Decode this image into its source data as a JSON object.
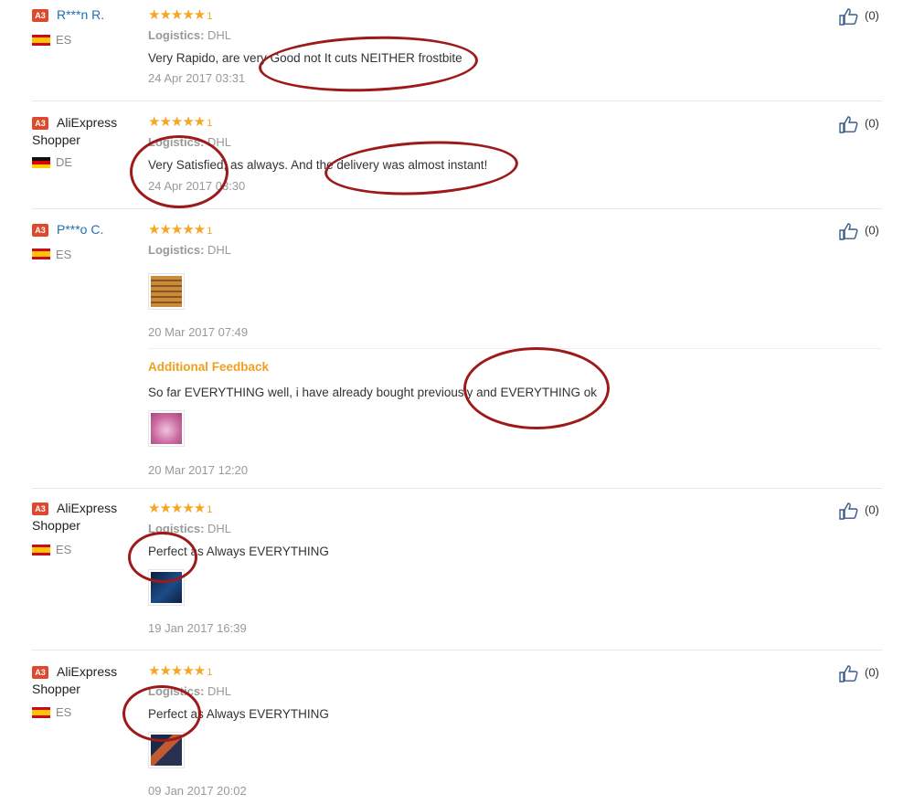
{
  "reviews": [
    {
      "badge": "A3",
      "user": "R***n R.",
      "country": "ES",
      "logistics_label": "Logistics:",
      "logistics": "DHL",
      "rating": "★★★★★",
      "rating_suffix": "1",
      "text": "Very Rapido, are very Good not It cuts NEITHER frostbite",
      "date": "24 Apr 2017 03:31",
      "likes": "(0)"
    },
    {
      "badge": "A3",
      "user": "AliExpress Shopper",
      "country": "DE",
      "logistics_label": "Logistics:",
      "logistics": "DHL",
      "rating": "★★★★★",
      "rating_suffix": "1",
      "text": "Very Satisfied, as always. And the delivery was almost instant!",
      "date": "24 Apr 2017 03:30",
      "likes": "(0)"
    },
    {
      "badge": "A3",
      "user": "P***o C.",
      "country": "ES",
      "logistics_label": "Logistics:",
      "logistics": "DHL",
      "rating": "★★★★★",
      "rating_suffix": "1",
      "date": "20 Mar 2017 07:49",
      "additional_label": "Additional Feedback",
      "additional_text": "So far EVERYTHING well, i have already bought previously and EVERYTHING ok",
      "additional_date": "20 Mar 2017 12:20",
      "likes": "(0)"
    },
    {
      "badge": "A3",
      "user": "AliExpress Shopper",
      "country": "ES",
      "logistics_label": "Logistics:",
      "logistics": "DHL",
      "rating": "★★★★★",
      "rating_suffix": "1",
      "text": "Perfect as Always EVERYTHING",
      "date": "19 Jan 2017 16:39",
      "likes": "(0)"
    },
    {
      "badge": "A3",
      "user": "AliExpress Shopper",
      "country": "ES",
      "logistics_label": "Logistics:",
      "logistics": "DHL",
      "rating": "★★★★★",
      "rating_suffix": "1",
      "text": "Perfect as Always EVERYTHING",
      "date": "09 Jan 2017 20:02",
      "likes": "(0)"
    }
  ],
  "colors": {
    "star": "#f5a623",
    "link": "#1f6fb5",
    "badge": "#e0482e",
    "annotation": "#9e1a1a",
    "additional": "#f0a020"
  },
  "icons": {
    "like": "thumbs-up-icon",
    "photo": "review-photo"
  }
}
